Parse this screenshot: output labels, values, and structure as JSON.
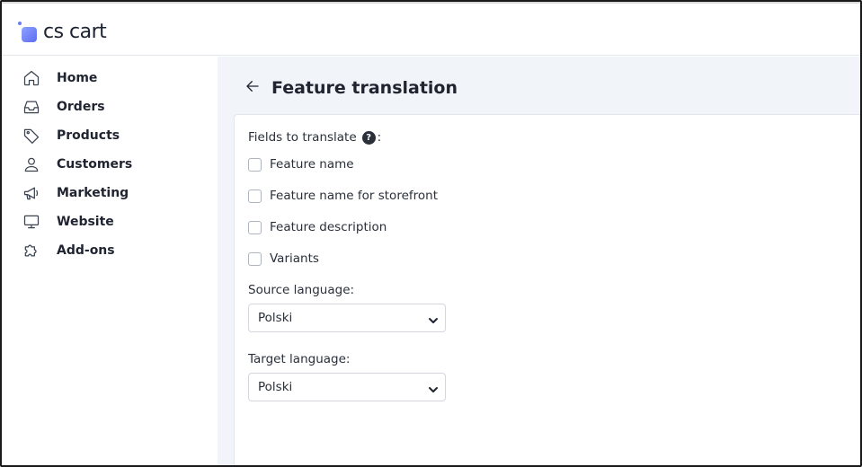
{
  "app": {
    "logo_text": "cs cart"
  },
  "sidebar": {
    "items": [
      {
        "label": "Home",
        "icon": "home-icon"
      },
      {
        "label": "Orders",
        "icon": "inbox-icon"
      },
      {
        "label": "Products",
        "icon": "tag-icon"
      },
      {
        "label": "Customers",
        "icon": "user-icon"
      },
      {
        "label": "Marketing",
        "icon": "megaphone-icon"
      },
      {
        "label": "Website",
        "icon": "monitor-icon"
      },
      {
        "label": "Add-ons",
        "icon": "puzzle-icon"
      }
    ]
  },
  "page": {
    "title": "Feature translation"
  },
  "form": {
    "fields_label": "Fields to translate",
    "help_glyph": "?",
    "colon": ":",
    "checkboxes": [
      {
        "label": "Feature name",
        "checked": false
      },
      {
        "label": "Feature name for storefront",
        "checked": false
      },
      {
        "label": "Feature description",
        "checked": false
      },
      {
        "label": "Variants",
        "checked": false
      }
    ],
    "source_language": {
      "label": "Source language:",
      "value": "Polski"
    },
    "target_language": {
      "label": "Target language:",
      "value": "Polski"
    }
  }
}
